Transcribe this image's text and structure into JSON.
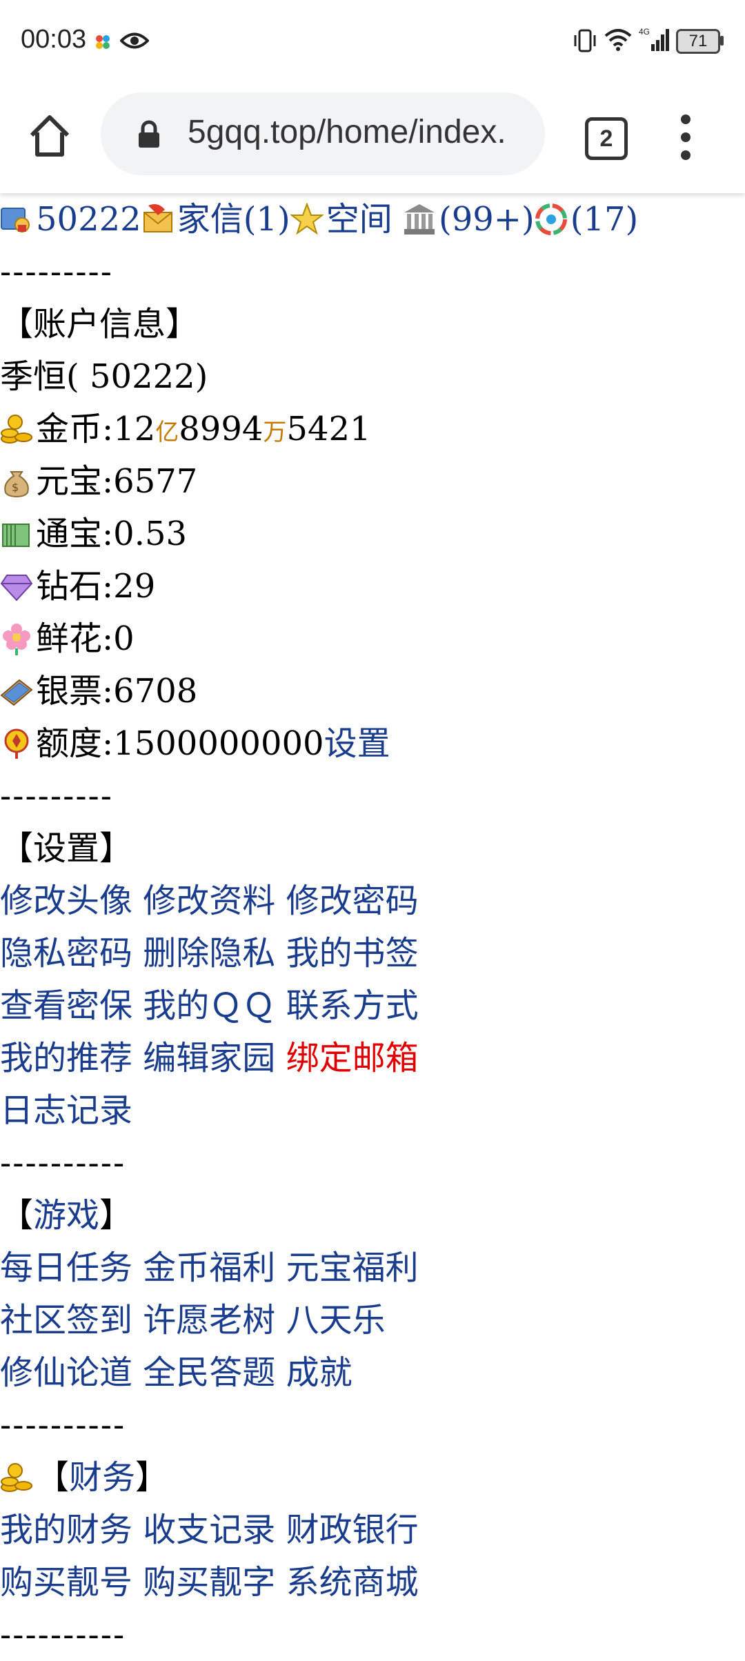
{
  "status_bar": {
    "time": "00:03",
    "battery": "71"
  },
  "browser": {
    "url": "5gqq.top/home/index.",
    "tab_count": "2"
  },
  "top_links": {
    "user_id": "50222",
    "mail": "家信(1)",
    "space": "空间",
    "bank_count": "(99+)",
    "photo_count": "(17)"
  },
  "separator_a": "---------",
  "separator_b": "----------",
  "account": {
    "heading": "【账户信息】",
    "name_id": "季恒( 50222)",
    "gold_label": "金币:",
    "gold_yi": "12",
    "unit_yi": "亿",
    "gold_wan": "8994",
    "unit_wan": "万",
    "gold_rest": "5421",
    "yuanbao": "元宝:6577",
    "tongbao": "通宝:0.53",
    "diamond": "钻石:29",
    "flower": "鲜花:0",
    "banknote": "银票:6708",
    "quota": "额度:1500000000",
    "quota_set": "设置"
  },
  "settings": {
    "heading": "【设置】",
    "rows": [
      [
        "修改头像",
        "修改资料",
        "修改密码"
      ],
      [
        "隐私密码",
        "删除隐私",
        "我的书签"
      ],
      [
        "查看密保",
        "我的ＱＱ",
        "联系方式"
      ],
      [
        "我的推荐",
        "编辑家园",
        "绑定邮箱"
      ],
      [
        "日志记录"
      ]
    ]
  },
  "games": {
    "heading_open": "【",
    "heading_text": "游戏",
    "heading_close": "】",
    "rows": [
      [
        "每日任务",
        "金币福利",
        "元宝福利"
      ],
      [
        "社区签到",
        "许愿老树",
        "八天乐"
      ],
      [
        "修仙论道",
        "全民答题",
        "成就"
      ]
    ]
  },
  "finance": {
    "heading_open": "【",
    "heading_text": "财务",
    "heading_close": "】",
    "rows": [
      [
        "我的财务",
        "收支记录",
        "财政银行"
      ],
      [
        "购买靓号",
        "购买靓字",
        "系统商城"
      ]
    ]
  },
  "colors": {
    "link": "#1a3c8c",
    "alert_link": "#e00000",
    "unit": "#c47a00"
  }
}
